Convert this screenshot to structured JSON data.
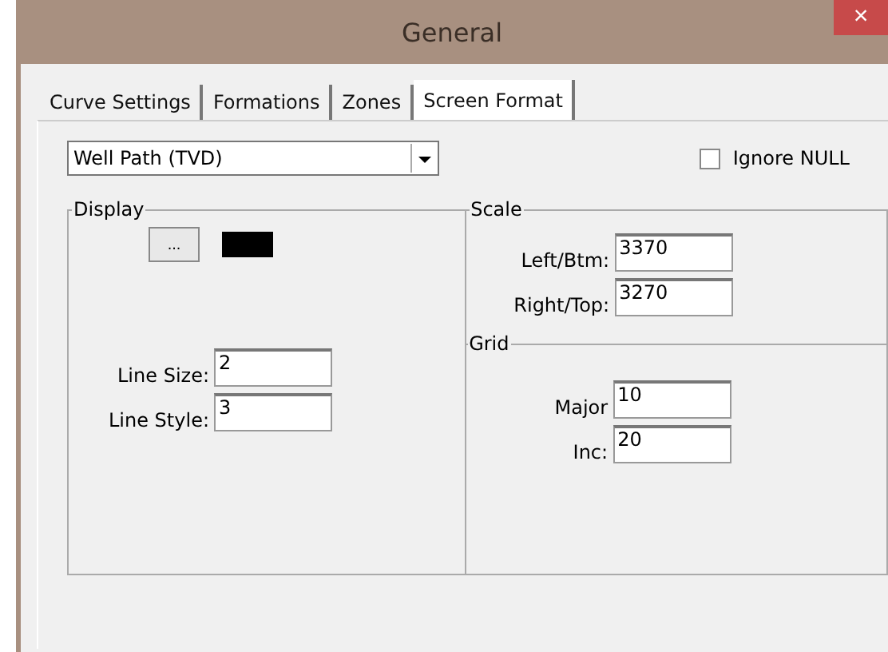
{
  "window": {
    "title": "General",
    "close": "×"
  },
  "tabs": [
    {
      "label": "Curve Settings",
      "selected": false
    },
    {
      "label": "Formations",
      "selected": false
    },
    {
      "label": "Zones",
      "selected": false
    },
    {
      "label": "Screen Format",
      "selected": true
    }
  ],
  "curve_select": {
    "value": "Well Path (TVD)"
  },
  "ignore_null": {
    "label": "Ignore NULL",
    "checked": false
  },
  "display": {
    "title": "Display",
    "button": "...",
    "color": "#000000",
    "fields": [
      {
        "label": "Line Size:",
        "value": "2"
      },
      {
        "label": "Line Style:",
        "value": "3"
      }
    ]
  },
  "scale": {
    "title": "Scale",
    "fields": [
      {
        "label": "Left/Btm:",
        "value": "3370"
      },
      {
        "label": "Right/Top:",
        "value": "3270"
      }
    ]
  },
  "grid": {
    "title": "Grid",
    "fields": [
      {
        "label": "Major",
        "value": "10"
      },
      {
        "label": "Inc:",
        "value": "20"
      }
    ]
  }
}
